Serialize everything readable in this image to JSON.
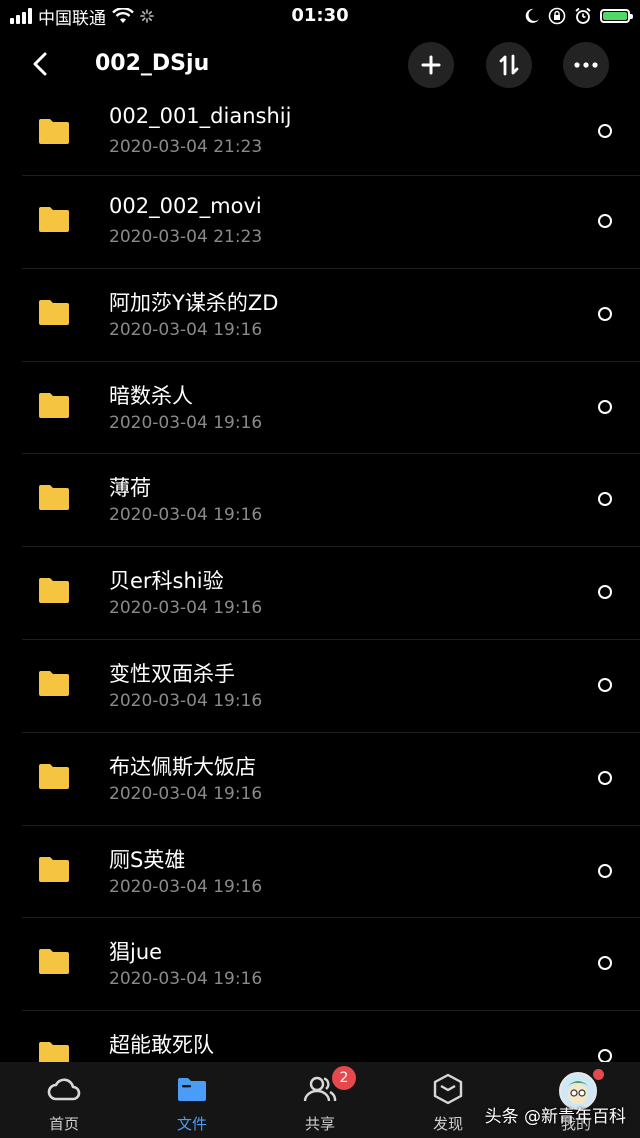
{
  "status_bar": {
    "carrier": "中国联通",
    "time": "01:30"
  },
  "header": {
    "title": "002_DSju"
  },
  "files": [
    {
      "name": "002_001_dianshij",
      "date": "2020-03-04 21:23"
    },
    {
      "name": "002_002_movi",
      "date": "2020-03-04 21:23"
    },
    {
      "name": "阿加莎Y谋杀的ZD",
      "date": "2020-03-04 19:16"
    },
    {
      "name": "暗数杀人",
      "date": "2020-03-04 19:16"
    },
    {
      "name": "薄荷",
      "date": "2020-03-04 19:16"
    },
    {
      "name": "贝er科shi验",
      "date": "2020-03-04 19:16"
    },
    {
      "name": "变性双面杀手",
      "date": "2020-03-04 19:16"
    },
    {
      "name": "布达佩斯大饭店",
      "date": "2020-03-04 19:16"
    },
    {
      "name": "厕S英雄",
      "date": "2020-03-04 19:16"
    },
    {
      "name": "猖jue",
      "date": "2020-03-04 19:16"
    },
    {
      "name": "超能敢死队",
      "date": ""
    }
  ],
  "tabs": [
    {
      "label": "首页",
      "icon": "cloud-icon"
    },
    {
      "label": "文件",
      "icon": "folder-icon",
      "active": true
    },
    {
      "label": "共享",
      "icon": "share-users-icon",
      "badge": "2"
    },
    {
      "label": "发现",
      "icon": "cube-icon"
    },
    {
      "label": "我的",
      "icon": "avatar-icon"
    }
  ],
  "watermark": "头条 @新青年百科",
  "colors": {
    "folder": "#F5C542",
    "accent": "#4A9CF7",
    "badge": "#E5484D",
    "battery": "#4CD964"
  }
}
